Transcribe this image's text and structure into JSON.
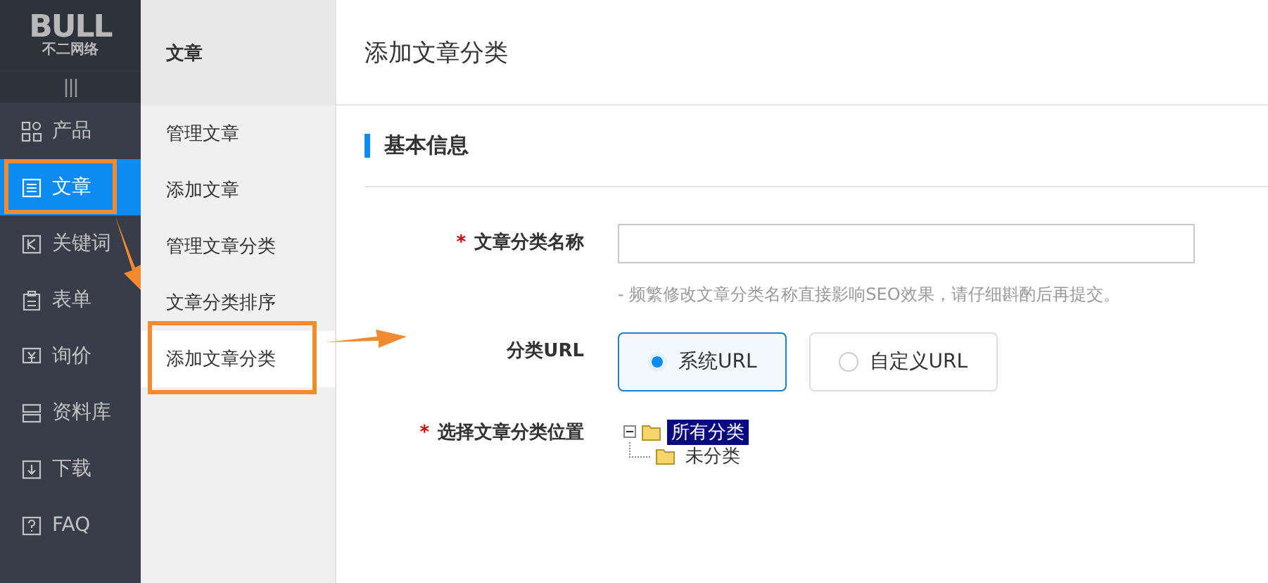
{
  "logo": {
    "text": "BULL",
    "subtitle": "不二网络"
  },
  "nav_items": [
    {
      "label": "产品",
      "selected": false
    },
    {
      "label": "文章",
      "selected": true
    },
    {
      "label": "关键词",
      "selected": false
    },
    {
      "label": "表单",
      "selected": false
    },
    {
      "label": "询价",
      "selected": false
    },
    {
      "label": "资料库",
      "selected": false
    },
    {
      "label": "下载",
      "selected": false
    },
    {
      "label": "FAQ",
      "selected": false
    }
  ],
  "submenu": {
    "title": "文章",
    "items": [
      {
        "label": "管理文章",
        "selected": false
      },
      {
        "label": "添加文章",
        "selected": false
      },
      {
        "label": "管理文章分类",
        "selected": false
      },
      {
        "label": "文章分类排序",
        "selected": false
      },
      {
        "label": "添加文章分类",
        "selected": true
      }
    ]
  },
  "page_title": "添加文章分类",
  "section_title": "基本信息",
  "form": {
    "name_field": {
      "label": "文章分类名称",
      "required_mark": "*",
      "hint": "- 频繁修改文章分类名称直接影响SEO效果，请仔细斟酌后再提交。"
    },
    "url_type": {
      "label": "分类URL",
      "options": [
        {
          "label": "系统URL",
          "selected": true
        },
        {
          "label": "自定义URL",
          "selected": false
        }
      ]
    },
    "position": {
      "label": "选择文章分类位置",
      "required_mark": "*",
      "tree": [
        {
          "label": "所有分类",
          "selected": true,
          "expanded": true,
          "children": [
            {
              "label": "未分类",
              "selected": false
            }
          ]
        }
      ]
    }
  }
}
